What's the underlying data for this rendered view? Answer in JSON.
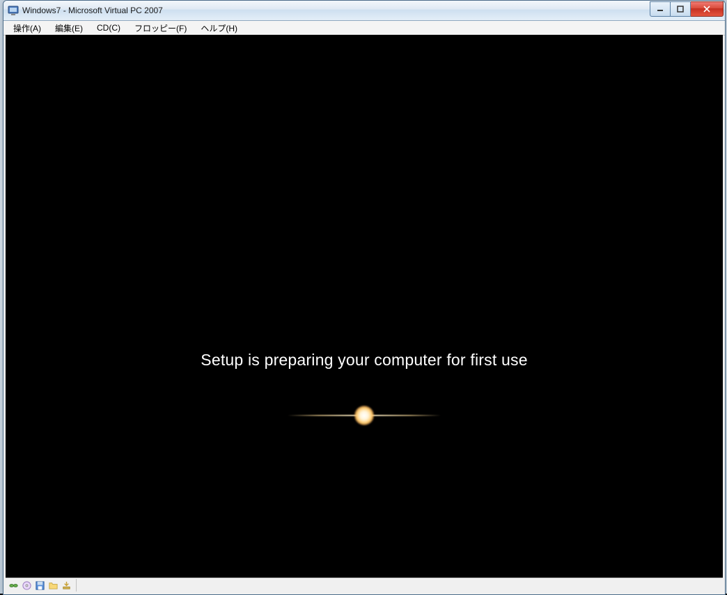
{
  "window": {
    "title": "Windows7 - Microsoft Virtual PC 2007"
  },
  "menu": {
    "action": "操作(A)",
    "edit": "編集(E)",
    "cd": "CD(C)",
    "floppy": "フロッピー(F)",
    "help": "ヘルプ(H)"
  },
  "content": {
    "setup_message": "Setup is preparing your computer for first use"
  },
  "statusbar": {
    "icons": [
      "network-icon",
      "disc-icon",
      "floppy-icon",
      "folder-icon",
      "install-icon"
    ]
  }
}
